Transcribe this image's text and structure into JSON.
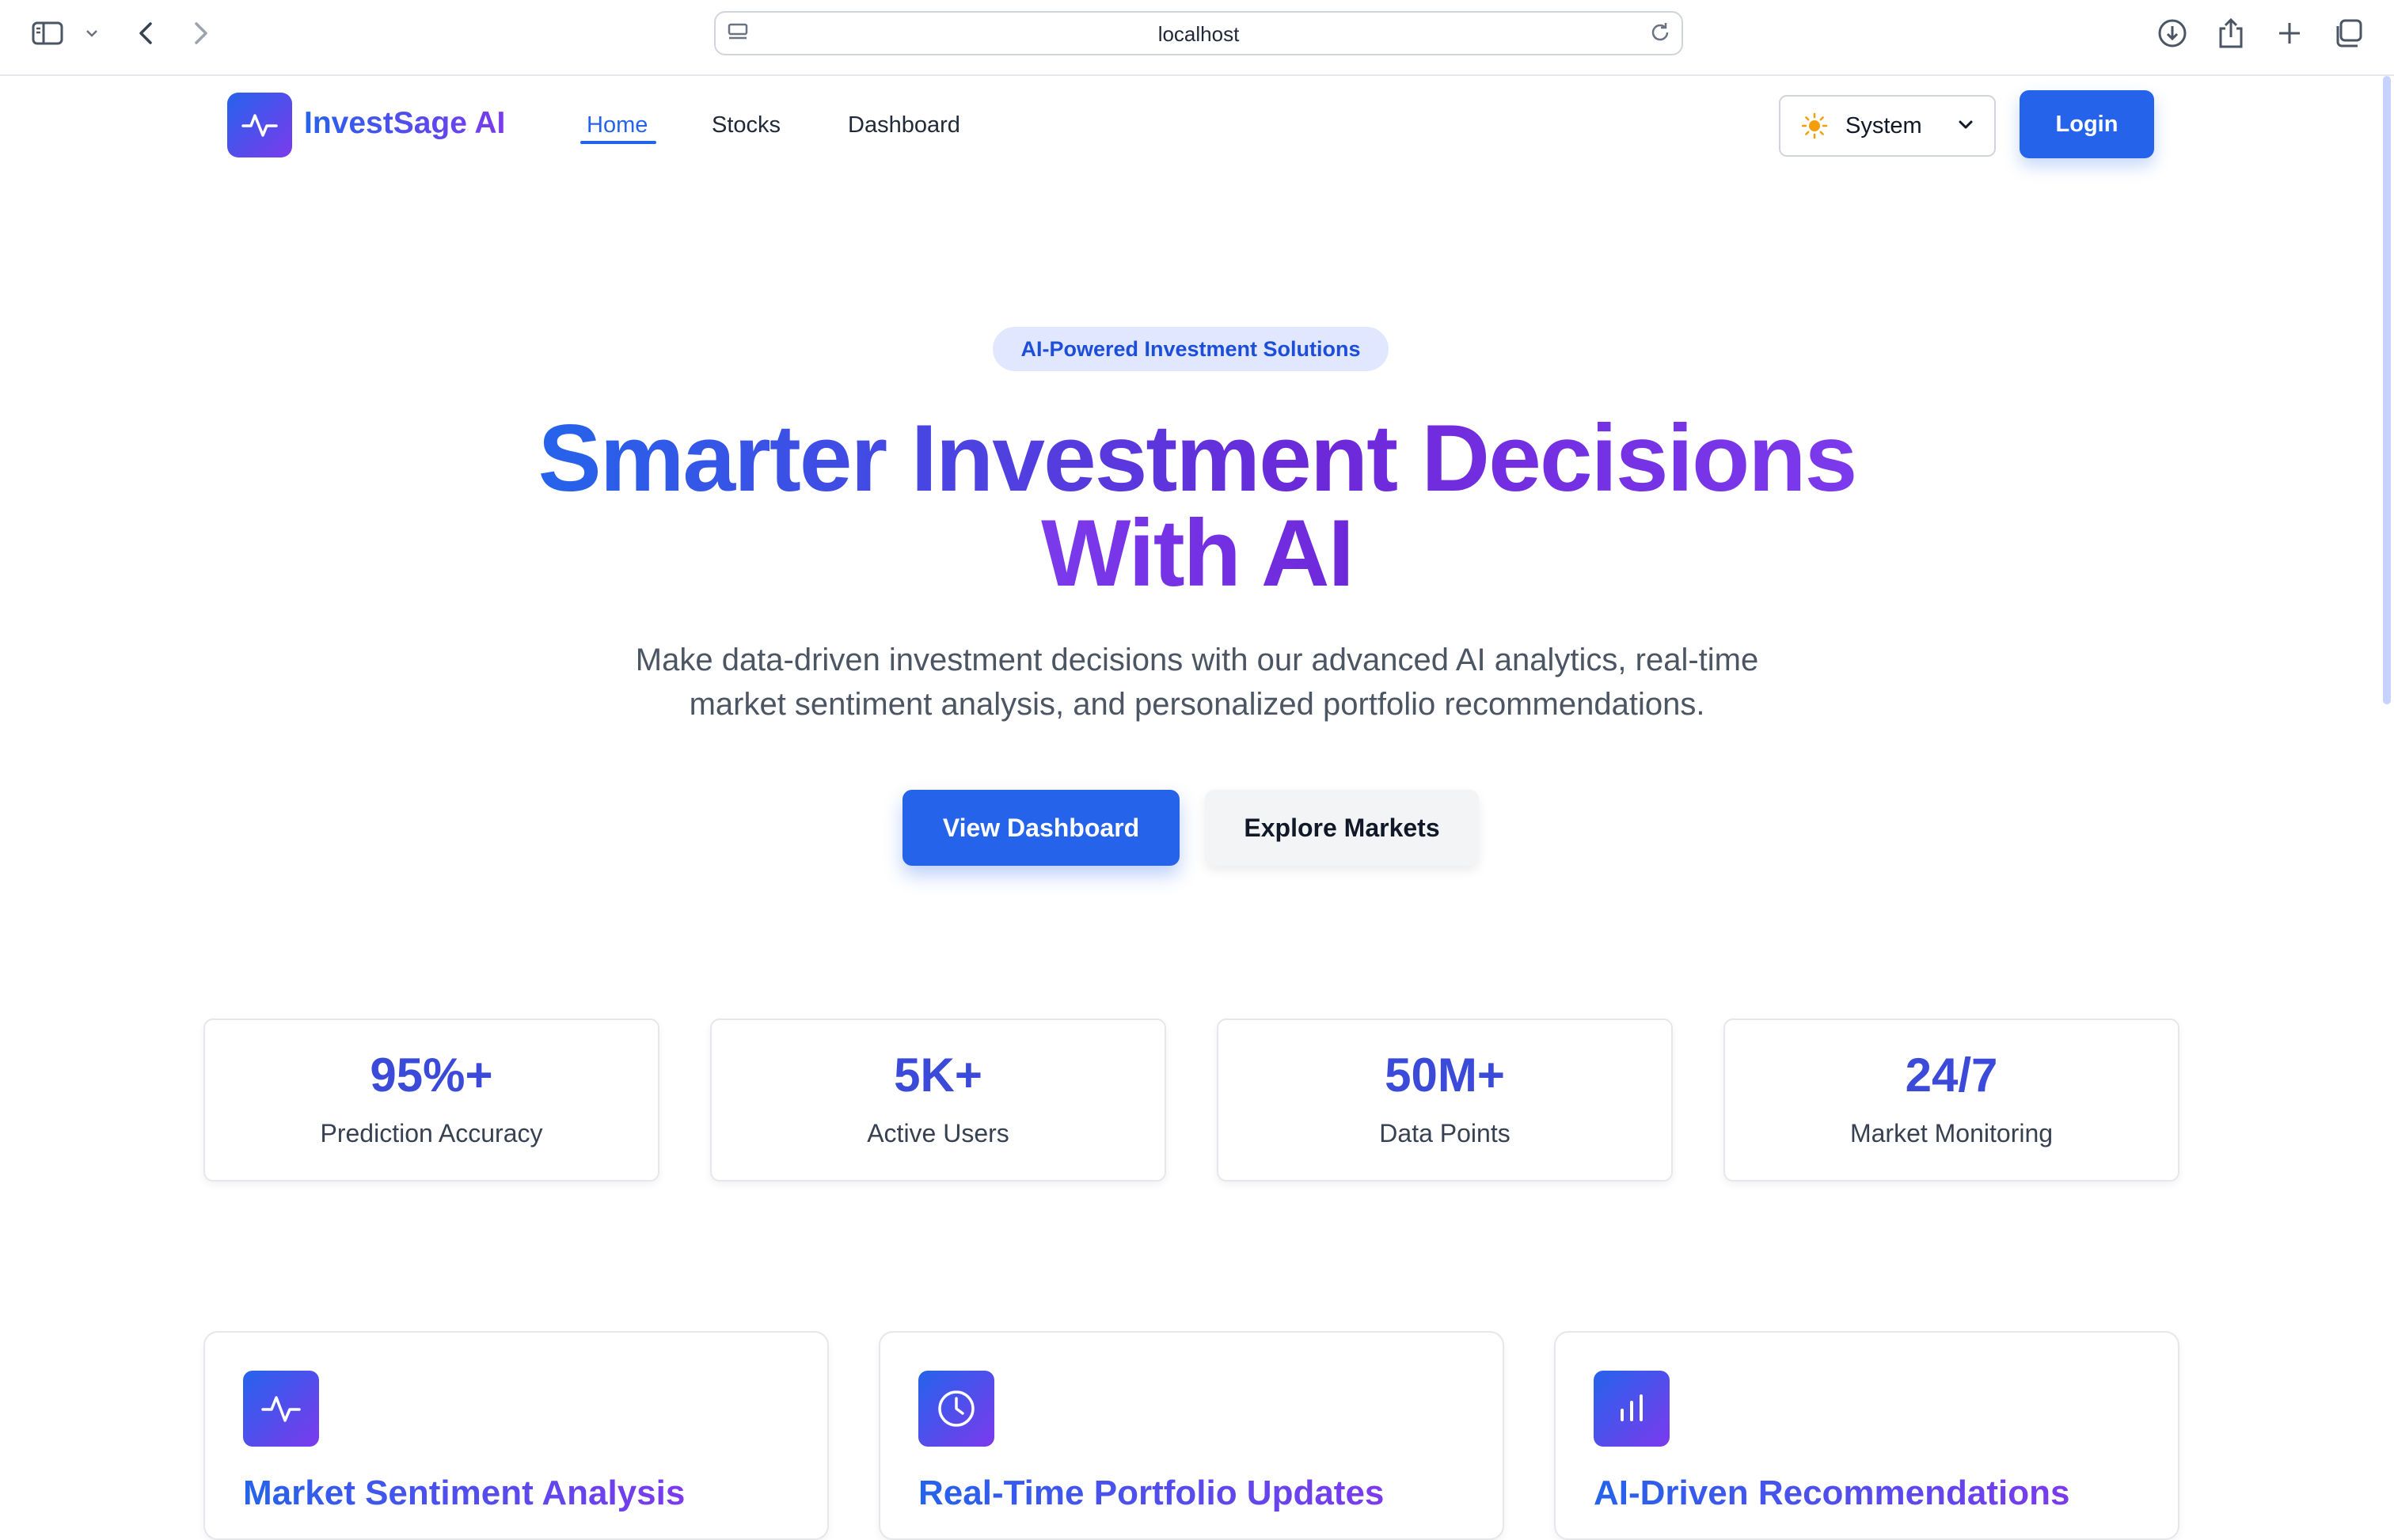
{
  "browser": {
    "url": "localhost"
  },
  "nav": {
    "brand": "InvestSage AI",
    "links": [
      "Home",
      "Stocks",
      "Dashboard"
    ],
    "active_link": "Home",
    "theme_value": "System",
    "login_label": "Login"
  },
  "hero": {
    "badge": "AI-Powered Investment Solutions",
    "headline_line1": "Smarter Investment Decisions",
    "headline_line2": "With AI",
    "subtitle_line1": "Make data-driven investment decisions with our advanced AI analytics, real-time",
    "subtitle_line2": "market sentiment analysis, and personalized portfolio recommendations.",
    "primary_cta": "View Dashboard",
    "secondary_cta": "Explore Markets"
  },
  "stats": [
    {
      "value": "95%+",
      "label": "Prediction Accuracy"
    },
    {
      "value": "5K+",
      "label": "Active Users"
    },
    {
      "value": "50M+",
      "label": "Data Points"
    },
    {
      "value": "24/7",
      "label": "Market Monitoring"
    }
  ],
  "features": [
    {
      "icon": "activity-icon",
      "title": "Market Sentiment Analysis"
    },
    {
      "icon": "clock-icon",
      "title": "Real-Time Portfolio Updates"
    },
    {
      "icon": "bar-chart-icon",
      "title": "AI-Driven Recommendations"
    }
  ],
  "colors": {
    "primary": "#2563eb",
    "accent": "#7c3aed",
    "stat_value": "#3b4ad8"
  }
}
